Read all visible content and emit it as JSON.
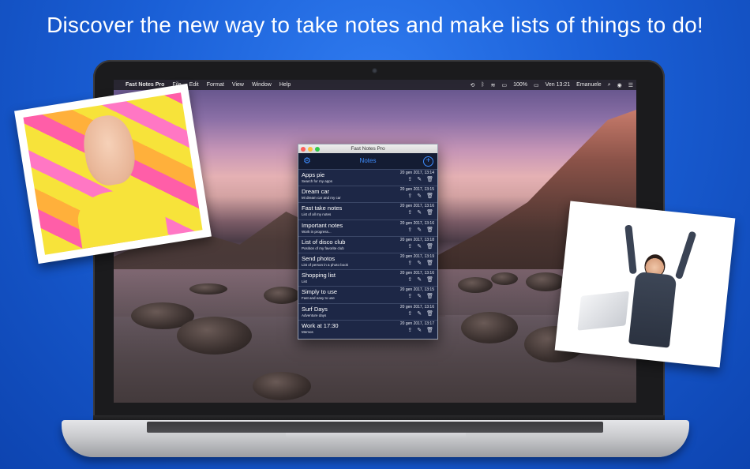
{
  "headline": "Discover the new way to take notes and make lists of things to do!",
  "menubar": {
    "apple": "",
    "app_name": "Fast Notes Pro",
    "menus": [
      "File",
      "Edit",
      "Format",
      "View",
      "Window",
      "Help"
    ],
    "battery": "100%",
    "clock": "Ven 13:21",
    "user": "Emanuele"
  },
  "window": {
    "title": "Fast Notes Pro",
    "toolbar_title": "Notes",
    "notes": [
      {
        "title": "Apps pie",
        "subtitle": "Search for my apps",
        "date": "20 gen 2017, 13:14"
      },
      {
        "title": "Dream car",
        "subtitle": "Mi dream car and my car",
        "date": "20 gen 2017, 13:15"
      },
      {
        "title": "Fast take notes",
        "subtitle": "List of all my notes",
        "date": "20 gen 2017, 13:16"
      },
      {
        "title": "Important notes",
        "subtitle": "Work in progress...",
        "date": "20 gen 2017, 13:16"
      },
      {
        "title": "List of disco club",
        "subtitle": "Position of my favorite club",
        "date": "20 gen 2017, 13:18"
      },
      {
        "title": "Send photos",
        "subtitle": "List of person in a photo book",
        "date": "20 gen 2017, 13:19"
      },
      {
        "title": "Shopping list",
        "subtitle": "List",
        "date": "20 gen 2017, 13:16"
      },
      {
        "title": "Simply to use",
        "subtitle": "Fast and easy to use",
        "date": "20 gen 2017, 13:15"
      },
      {
        "title": "Surf Days",
        "subtitle": "Adventure days",
        "date": "20 gen 2017, 13:16"
      },
      {
        "title": "Work at 17:30",
        "subtitle": "Memos",
        "date": "20 gen 2017, 13:17"
      }
    ]
  },
  "icons": {
    "settings": "⚙",
    "add": "+",
    "share": "⇪",
    "edit": "✎",
    "delete": "🗑"
  },
  "colors": {
    "background": "#1a5fd6",
    "window_bg": "#1d2746",
    "accent": "#3e8dff",
    "traffic_close": "#fc605b",
    "traffic_min": "#fdbc40",
    "traffic_max": "#34c84a"
  }
}
